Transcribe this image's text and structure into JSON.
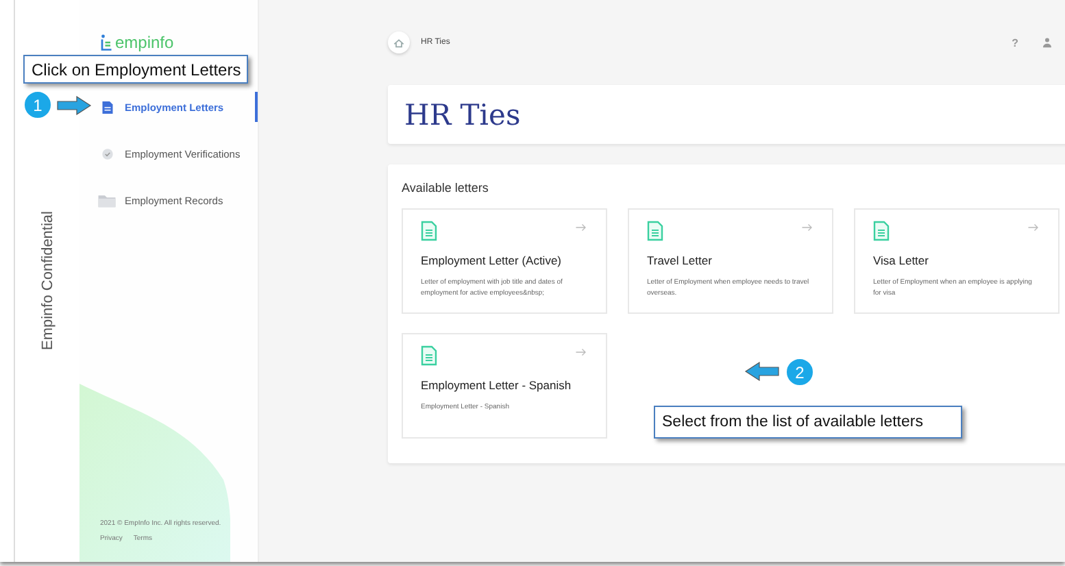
{
  "side_label": "Empinfo Confidential",
  "logo": "empinfo",
  "nav": [
    {
      "label": "Employment Letters",
      "selected": true,
      "kind": "doc"
    },
    {
      "label": "Employment Verifications",
      "selected": false,
      "kind": "check"
    },
    {
      "label": "Employment Records",
      "selected": false,
      "kind": "folder"
    }
  ],
  "footer": {
    "copyright": "2021 © EmpInfo Inc. All rights reserved.",
    "links": [
      "Privacy",
      "Terms"
    ]
  },
  "breadcrumb": "HR Ties",
  "help": "?",
  "page_title": "HR Ties",
  "section_title": "Available letters",
  "letters": [
    {
      "title": "Employment Letter (Active)",
      "description": "Letter of employment with job title and dates of employment for active employees&nbsp;"
    },
    {
      "title": "Travel Letter",
      "description": "Letter of Employment when employee needs to travel overseas."
    },
    {
      "title": "Visa Letter",
      "description": "Letter of Employment when an employee is applying for visa"
    },
    {
      "title": "Employment Letter - Spanish",
      "description": "Employment Letter - Spanish"
    }
  ],
  "callouts": [
    {
      "step": "1",
      "text": "Click on Employment Letters"
    },
    {
      "step": "2",
      "text": "Select from the list of available letters"
    }
  ]
}
